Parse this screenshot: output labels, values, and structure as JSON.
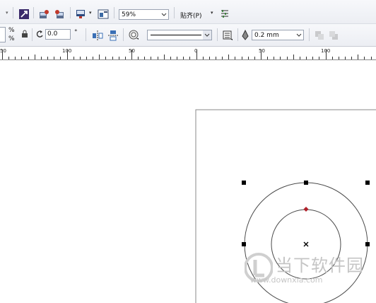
{
  "toolbar_top": {
    "zoom_value": "59%",
    "snap_label": "贴齐(P)"
  },
  "toolbar_prop": {
    "percent_top": "%",
    "percent_bottom": "%",
    "rotation_value": "0.0",
    "degree_symbol": "°",
    "outline_width_value": "0.2 mm"
  },
  "ruler": {
    "ticks": [
      "50",
      "100",
      "50",
      "0",
      "50",
      "100"
    ]
  },
  "watermark": {
    "text_cn": "当下软件园",
    "url": "www.downxia.com"
  },
  "colors": {
    "selection_handle": "#000000",
    "node_marker": "#b0202a",
    "shape_outline": "#4a4a4a",
    "page_border": "#8a8a8a"
  }
}
